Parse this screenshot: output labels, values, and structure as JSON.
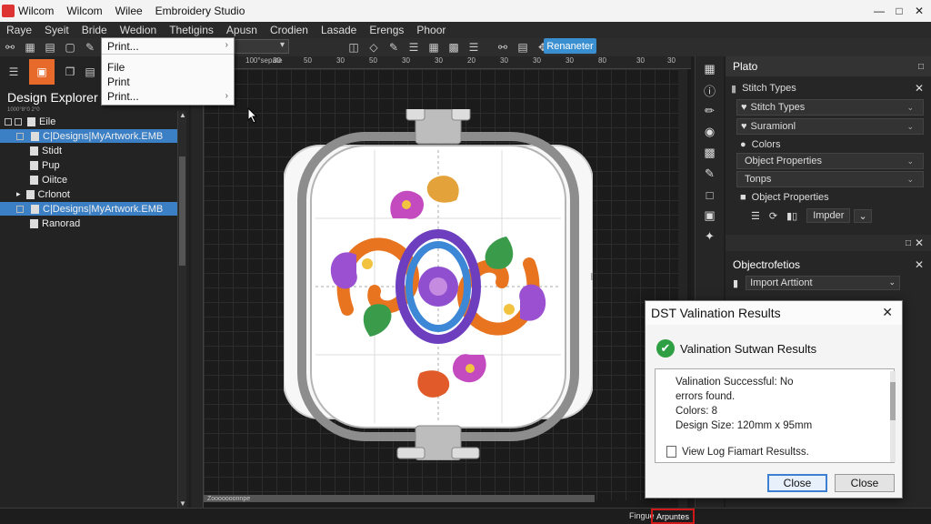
{
  "window": {
    "title": "Wilcom Embroidery Studio",
    "title_items": [
      "Wilcom",
      "Wilcom",
      "Wilee",
      "Embroidery Studio"
    ]
  },
  "menubar": {
    "items": [
      "Raye",
      "Syeit",
      "Bride",
      "Wedion",
      "Thetigins",
      "Apusn",
      "Crodien",
      "Lasade",
      "Erengs",
      "Phoor"
    ]
  },
  "toolbar": {
    "rename_label": "Renaneter",
    "print_label": "Print..."
  },
  "dropdown": {
    "top": "Print...",
    "items": [
      "File",
      "Print",
      "Print..."
    ]
  },
  "left_panel": {
    "title": "Design Explorer",
    "subtitle": "1000°8°0 2°0",
    "tree": [
      {
        "label": "Eile",
        "selected": false,
        "checkbox": true
      },
      {
        "label": "C|Designs|MyArtwork.EMB",
        "selected": true,
        "checkbox": true
      },
      {
        "label": "Stidt",
        "selected": false,
        "checkbox": false
      },
      {
        "label": "Pup",
        "selected": false,
        "checkbox": false
      },
      {
        "label": "Oiitce",
        "selected": false,
        "checkbox": false
      },
      {
        "label": "Crlonot",
        "selected": false,
        "checkbox": false,
        "expander": true
      },
      {
        "label": "C|Designs|MyArtwork.EMB",
        "selected": true,
        "checkbox": true
      },
      {
        "label": "Ranorad",
        "selected": false,
        "checkbox": false
      }
    ]
  },
  "canvas": {
    "ruler_labels": [
      "30",
      "50",
      "30",
      "50",
      "30",
      "30",
      "20",
      "30",
      "30",
      "30",
      "80",
      "30",
      "30",
      "30"
    ],
    "corner_label": "100°sepate",
    "bottom_label": "Zooooooonnpe"
  },
  "right_panel": {
    "header": "Plato",
    "stitch_section_title": "Stitch Types",
    "rows": [
      {
        "label": "Stitch Types",
        "type": "field"
      },
      {
        "label": "Suramionl",
        "type": "field"
      },
      {
        "label": "Colors",
        "type": "text"
      },
      {
        "label": "Object Properties",
        "type": "field"
      },
      {
        "label": "Tonps",
        "type": "field"
      },
      {
        "label": "Object Properties",
        "type": "text"
      }
    ],
    "impder_label": "Impder",
    "objprops_title": "Objectrofetios",
    "import_label": "Import Arttiont"
  },
  "dialog": {
    "title": "DST Valination Results",
    "heading": "Valination Sutwan Results",
    "lines": [
      "Valination Successful: No",
      "errors found.",
      "Colors: 8",
      "Design Size: 120mm x 95mm"
    ],
    "log_link": "View Log Fiamart Resultss.",
    "buttons": [
      "Close",
      "Close"
    ]
  },
  "statusbar": {
    "left_text": "Fingue",
    "highlight_text": "Arpuntes"
  },
  "colors": {
    "accent": "#3a8fd0",
    "orange": "#e86a2a",
    "highlight_red": "#d01818",
    "success": "#2ea043"
  }
}
